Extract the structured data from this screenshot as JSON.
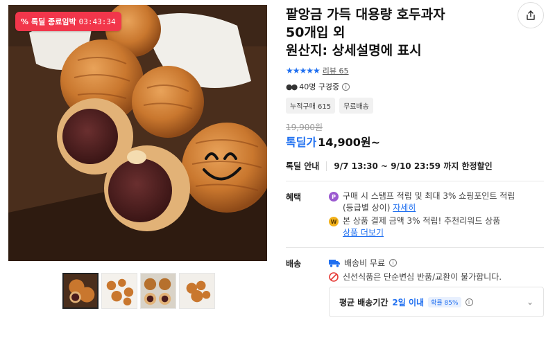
{
  "deal_badge": {
    "icon": "percent-tag-icon",
    "label": "톡딜 종료임박",
    "timer": "03:43:34"
  },
  "product": {
    "title_line1": "팥앙금 가득 대용량 호두과자",
    "title_line2": "50개입 외",
    "title_line3": "원산지: 상세설명에 표시",
    "stars": "★★★★★",
    "review_label": "리뷰 65",
    "viewers": "40명 구경중",
    "tags": [
      "누적구매 615",
      "무료배송"
    ],
    "original_price": "19,900원",
    "price_label": "톡딜가",
    "price": "14,900원~"
  },
  "deal_info": {
    "label": "톡딜 안내",
    "period": "9/7 13:30 ~ 9/10 23:59 까지 한정할인"
  },
  "benefits": {
    "label": "혜택",
    "item1_text": "구매 시 스탬프 적립 및 최대 3% 쇼핑포인트 적립",
    "item1_sub": "(등급별 상이)",
    "item1_link": "자세히",
    "item2_text": "본 상품 결제 금액 3% 적립! 추천리워드 상품",
    "item2_link": "상품 더보기"
  },
  "shipping": {
    "label": "배송",
    "free": "배송비 무료",
    "notice": "신선식품은 단순변심 반품/교환이 불가합니다.",
    "delivery_label": "평균 배송기간",
    "delivery_days": "2일 이내",
    "probability": "확률 85%"
  },
  "colors": {
    "accent": "#1f6ff0",
    "badge": "#f2364b"
  }
}
